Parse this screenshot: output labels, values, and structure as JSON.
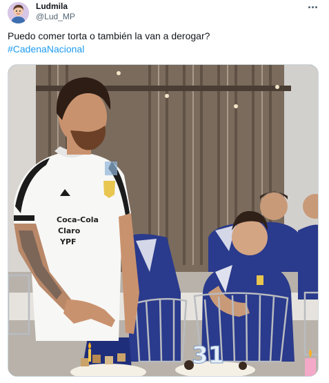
{
  "tweet": {
    "author": {
      "display_name": "Ludmila",
      "handle": "@Lud_MP",
      "avatar_icon": "cartoon-avatar"
    },
    "text_line1": "Puedo comer torta o también la van a derogar?",
    "hashtag": "#CadenaNacional",
    "more_icon": "more-horizontal-icon"
  },
  "photo": {
    "shirt_sponsor_lines": [
      "Coca-Cola",
      "Claro",
      "YPF"
    ],
    "candle_numbers": "31"
  },
  "colors": {
    "link": "#1d9bf0",
    "text": "#0f1419",
    "secondary": "#536471",
    "border": "#cfd9de"
  }
}
